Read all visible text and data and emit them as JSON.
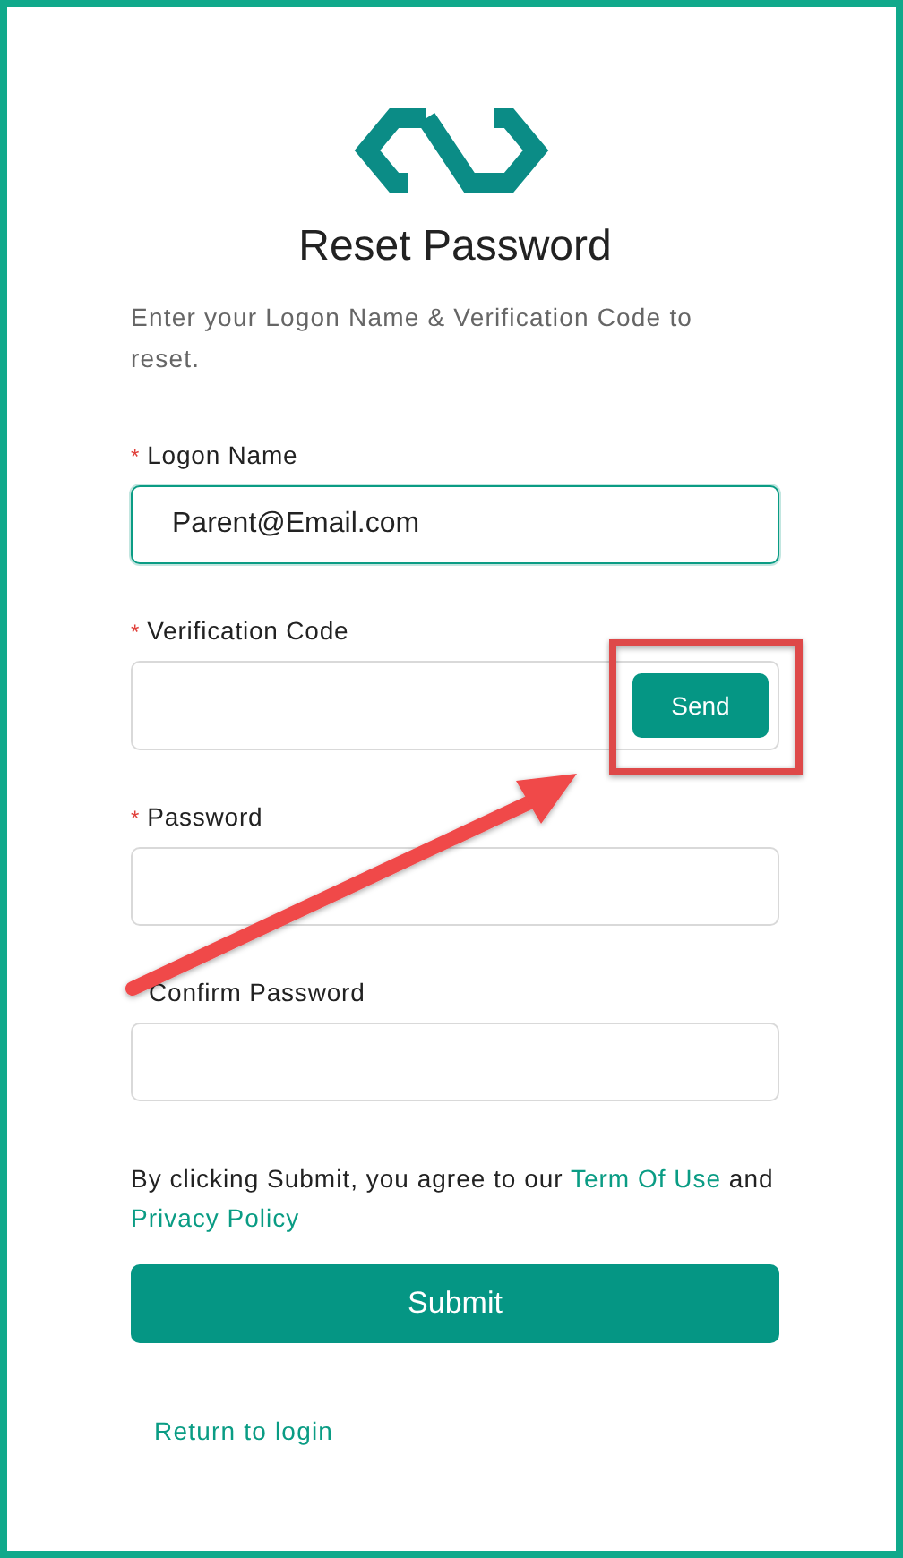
{
  "title": "Reset Password",
  "description": "Enter your Logon Name & Verification Code to reset.",
  "fields": [
    {
      "label": "Logon Name",
      "required_mark": "*",
      "value": "Parent@Email.com",
      "focused": true
    },
    {
      "label": "Verification Code",
      "required_mark": "*",
      "focused": false,
      "action": "Send"
    },
    {
      "label": "Password",
      "required_mark": "*",
      "focused": false
    },
    {
      "label": "Confirm Password",
      "focused": false
    }
  ],
  "consent": {
    "text_before": "By clicking Submit, you agree to our",
    "link_1": "Term Of Use",
    "text_middle": "and",
    "link_2": "Privacy Policy"
  },
  "submit": "Submit",
  "return_link": "Return to login",
  "annotations": {
    "highlight_box": true,
    "arrow": true
  }
}
